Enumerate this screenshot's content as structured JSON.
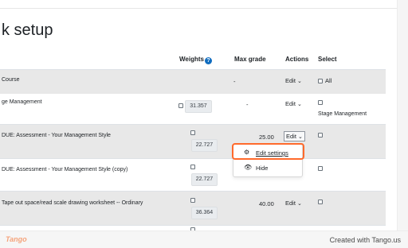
{
  "page": {
    "title": "k setup"
  },
  "table": {
    "headers": {
      "weights": "Weights",
      "max_grade": "Max grade",
      "actions": "Actions",
      "select": "Select"
    },
    "rows": [
      {
        "name": "Course",
        "max_grade": "-",
        "action": "Edit",
        "select_label": "All"
      },
      {
        "name": "ge Management",
        "weight": "31.357",
        "max_grade": "-",
        "action": "Edit",
        "select_label": "Stage Management"
      },
      {
        "name": "DUE: Assessment - Your Management Style",
        "weight": "22.727",
        "max_grade": "25.00",
        "action": "Edit"
      },
      {
        "name": "DUE: Assessment - Your Management Style (copy)",
        "weight": "22.727"
      },
      {
        "name": "Tape out space/read scale drawing worksheet -- Ordinary",
        "weight": "36.364",
        "max_grade": "40.00",
        "action": "Edit"
      }
    ]
  },
  "dropdown": {
    "items": [
      {
        "label": "Edit settings",
        "icon": "gear-icon"
      },
      {
        "label": "Hide",
        "icon": "eye-icon"
      }
    ]
  },
  "highlight_color": "#ff6a2c",
  "footer": {
    "logo": "Tango",
    "credit": "Created with Tango.us"
  }
}
